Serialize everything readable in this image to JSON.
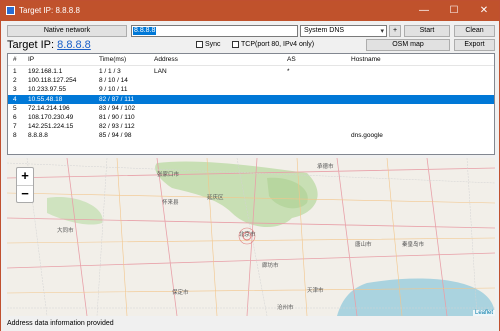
{
  "window": {
    "title": "Target IP: 8.8.8.8",
    "minimize": "—",
    "maximize": "☐",
    "close": "✕"
  },
  "toolbar": {
    "native_network_label": "Native network",
    "ip_value": "8.8.8.8",
    "dns_value": "System DNS",
    "plus_label": "+",
    "start_label": "Start",
    "clean_label": "Clean",
    "osm_map_label": "OSM map",
    "export_label": "Export"
  },
  "target": {
    "prefix": "Target IP: ",
    "ip": "8.8.8.8"
  },
  "options": {
    "sync_label": "Sync",
    "tcp_label": "TCP(port 80, IPv4 only)"
  },
  "table": {
    "headers": [
      "#",
      "IP",
      "Time(ms)",
      "Address",
      "AS",
      "Hostname"
    ],
    "rows": [
      [
        "1",
        "192.168.1.1",
        "1 / 1 / 3",
        "LAN",
        "*",
        ""
      ],
      [
        "2",
        "100.118.127.254",
        "8 / 10 / 14",
        "",
        "",
        ""
      ],
      [
        "3",
        "10.233.97.55",
        "9 / 10 / 11",
        "",
        "",
        ""
      ],
      [
        "4",
        "10.55.48.18",
        "82 / 87 / 111",
        "",
        "",
        ""
      ],
      [
        "5",
        "72.14.214.196",
        "83 / 94 / 102",
        "",
        "",
        ""
      ],
      [
        "6",
        "108.170.230.49",
        "81 / 90 / 110",
        "",
        "",
        ""
      ],
      [
        "7",
        "142.251.224.15",
        "82 / 93 / 112",
        "",
        "",
        ""
      ],
      [
        "8",
        "8.8.8.8",
        "85 / 94 / 98",
        "",
        "",
        "dns.google"
      ]
    ],
    "selected_row": 3
  },
  "map": {
    "zoom_in": "+",
    "zoom_out": "−",
    "attribution": "Leaflet",
    "labels": [
      "承德市",
      "张家口市",
      "北京市",
      "廊坊市",
      "天津市",
      "唐山市",
      "秦皇岛市",
      "保定市",
      "大同市",
      "怀来县",
      "延庆区",
      "沧州市"
    ]
  },
  "status": {
    "text": "Address data information provided"
  },
  "colors": {
    "titlebar": "#c0522c",
    "selection": "#0078d7",
    "link": "#1a5fc8"
  }
}
